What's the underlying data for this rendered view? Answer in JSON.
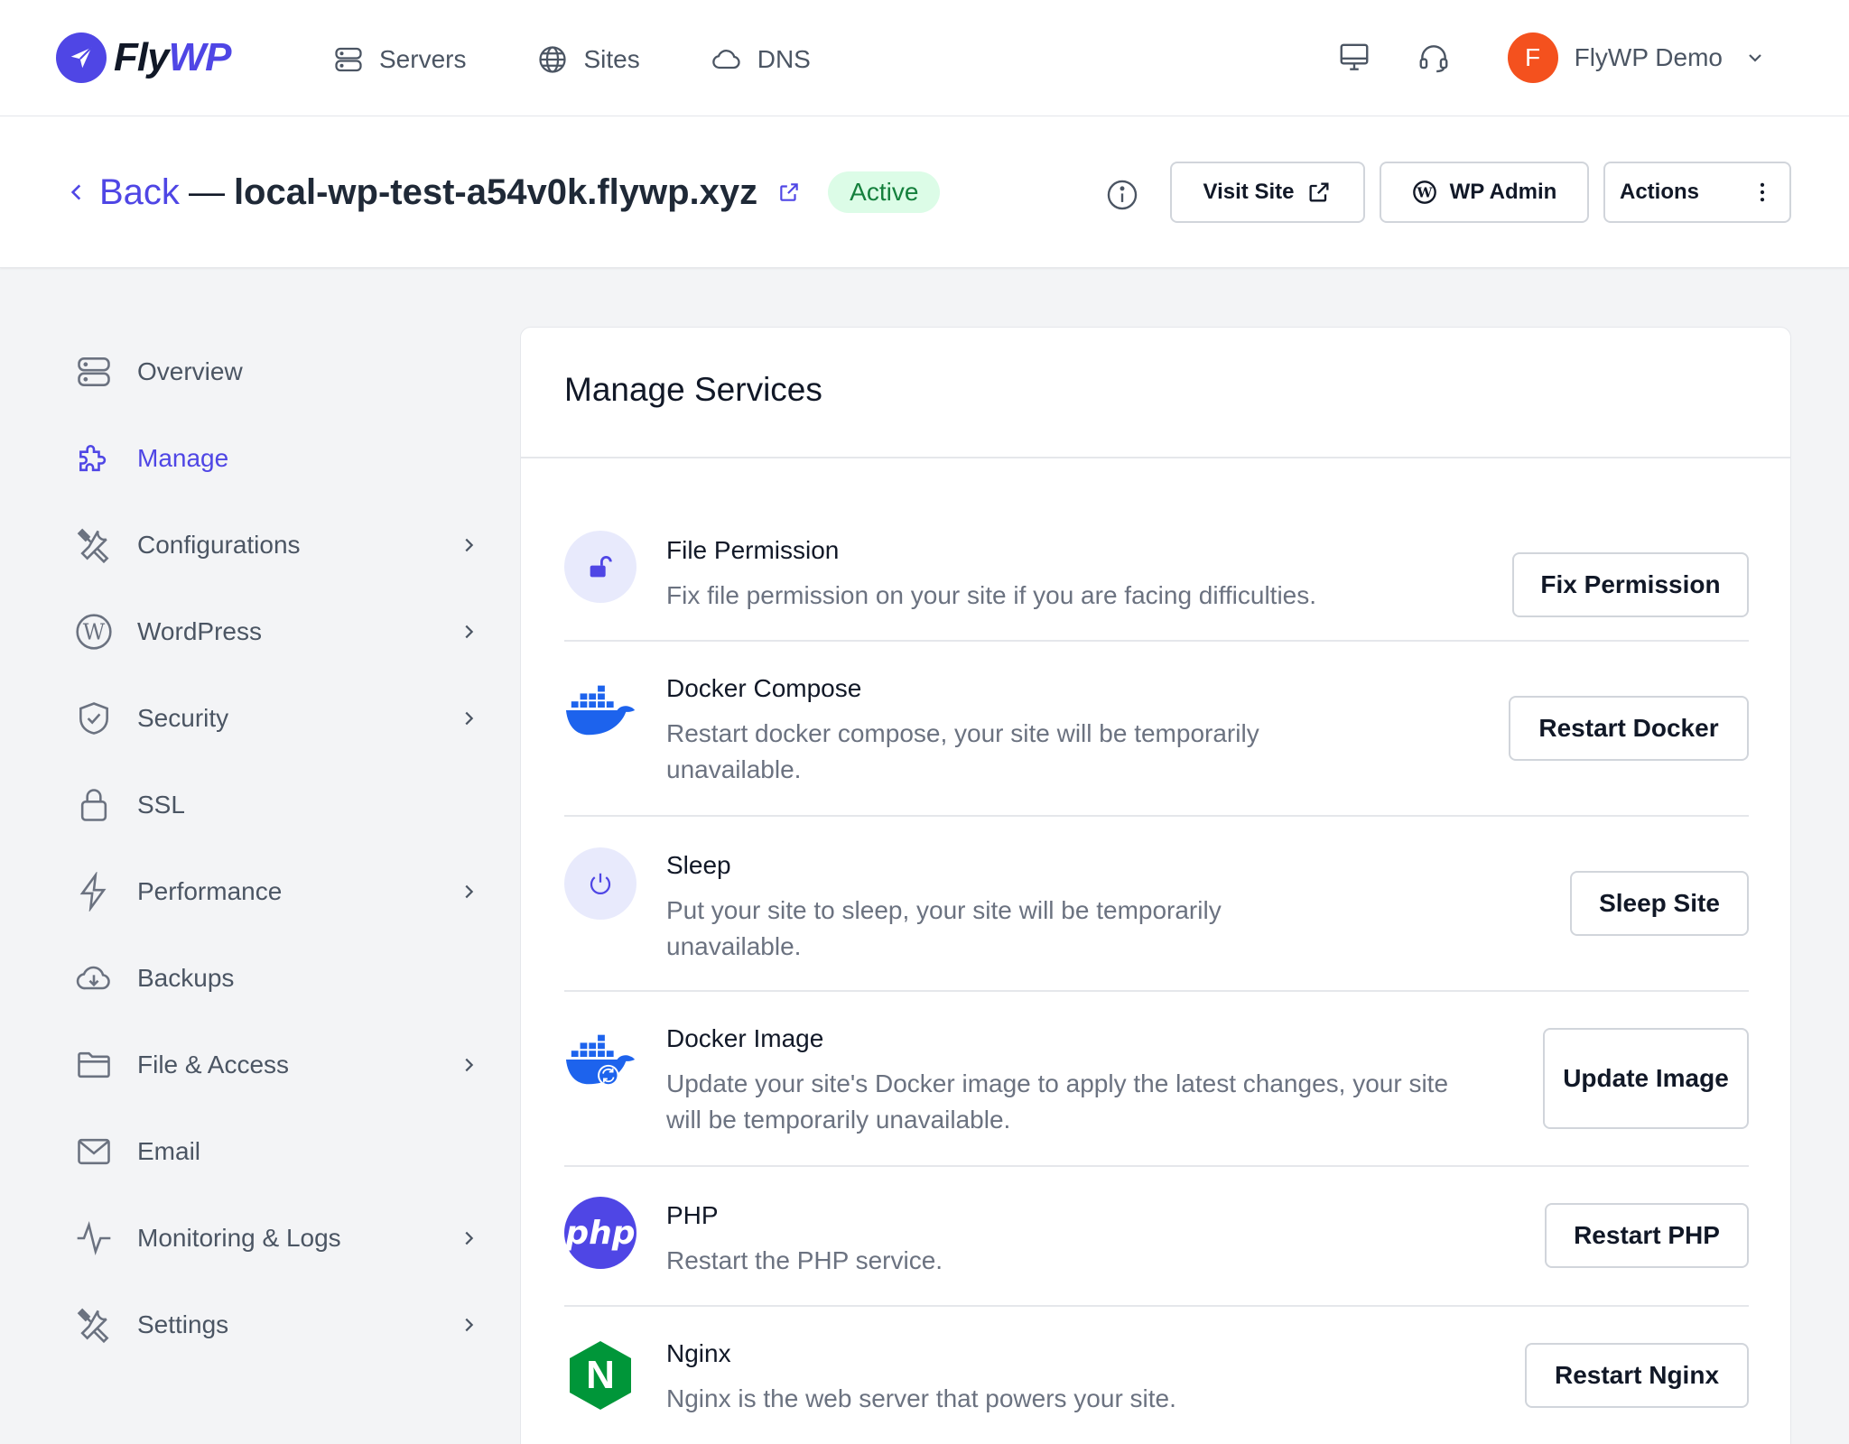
{
  "brand": {
    "name_main": "Fly",
    "name_accent": "WP"
  },
  "nav": {
    "items": [
      {
        "label": "Servers",
        "icon": "server-icon"
      },
      {
        "label": "Sites",
        "icon": "globe-icon"
      },
      {
        "label": "DNS",
        "icon": "cloud-icon"
      }
    ]
  },
  "user": {
    "initial": "F",
    "name": "FlyWP Demo"
  },
  "header": {
    "back_label": "Back",
    "separator": "—",
    "site_domain": "local-wp-test-a54v0k.flywp.xyz",
    "status": "Active",
    "buttons": {
      "visit": "Visit Site",
      "wp_admin": "WP Admin",
      "actions": "Actions"
    }
  },
  "sidebar": {
    "items": [
      {
        "label": "Overview",
        "icon": "server-icon",
        "has_children": false,
        "active": false
      },
      {
        "label": "Manage",
        "icon": "puzzle-icon",
        "has_children": false,
        "active": true
      },
      {
        "label": "Configurations",
        "icon": "tools-icon",
        "has_children": true,
        "active": false
      },
      {
        "label": "WordPress",
        "icon": "wordpress-icon",
        "has_children": true,
        "active": false
      },
      {
        "label": "Security",
        "icon": "shield-check-icon",
        "has_children": true,
        "active": false
      },
      {
        "label": "SSL",
        "icon": "lock-icon",
        "has_children": false,
        "active": false
      },
      {
        "label": "Performance",
        "icon": "bolt-icon",
        "has_children": true,
        "active": false
      },
      {
        "label": "Backups",
        "icon": "cloud-download-icon",
        "has_children": false,
        "active": false
      },
      {
        "label": "File & Access",
        "icon": "folder-icon",
        "has_children": true,
        "active": false
      },
      {
        "label": "Email",
        "icon": "mail-icon",
        "has_children": false,
        "active": false
      },
      {
        "label": "Monitoring & Logs",
        "icon": "activity-icon",
        "has_children": true,
        "active": false
      },
      {
        "label": "Settings",
        "icon": "tools-icon",
        "has_children": true,
        "active": false
      }
    ]
  },
  "main": {
    "title": "Manage Services",
    "services": [
      {
        "name": "File Permission",
        "description": "Fix file permission on your site if you are facing difficulties.",
        "button": "Fix Permission",
        "icon": "unlock-icon"
      },
      {
        "name": "Docker Compose",
        "description": "Restart docker compose, your site will be temporarily unavailable.",
        "button": "Restart Docker",
        "icon": "docker-icon"
      },
      {
        "name": "Sleep",
        "description": "Put your site to sleep, your site will be temporarily unavailable.",
        "button": "Sleep Site",
        "icon": "power-icon"
      },
      {
        "name": "Docker Image",
        "description": "Update your site's Docker image to apply the latest changes, your site will be temporarily unavailable.",
        "button": "Update Image",
        "icon": "docker-refresh-icon"
      },
      {
        "name": "PHP",
        "description": "Restart the PHP service.",
        "button": "Restart PHP",
        "icon": "php-icon",
        "icon_text": "php"
      },
      {
        "name": "Nginx",
        "description": "Nginx is the web server that powers your site.",
        "button": "Restart Nginx",
        "icon": "nginx-icon",
        "icon_text": "N"
      }
    ]
  },
  "colors": {
    "accent": "#4f46e5",
    "active_bg": "#dcfce7",
    "active_text": "#15803d",
    "avatar": "#f4511e",
    "docker": "#1d63ed",
    "php": "#4f46e5",
    "nginx": "#009639"
  }
}
